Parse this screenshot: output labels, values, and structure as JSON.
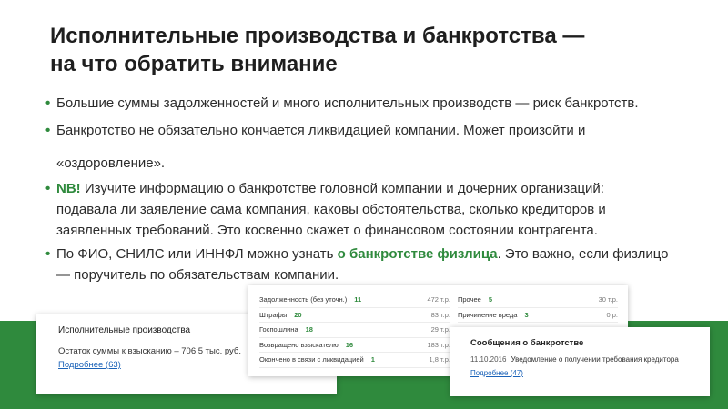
{
  "title_line1": "Исполнительные производства и банкротства —",
  "title_line2": "на что обратить внимание",
  "bullets": {
    "b1": "Большие суммы задолженностей и много исполнительных производств — риск банкротств.",
    "b2_line1": "Банкротство не обязательно кончается ликвидацией компании. Может произойти и",
    "b2_line2": "«оздоровление».",
    "b3_nb": "NB!",
    "b3_line1": " Изучите информацию о банкротстве головной компании и дочерних организаций:",
    "b3_line2": "подавала ли заявление сама компания, каковы обстоятельства, сколько кредиторов и",
    "b3_line3": "заявленных  требований. Это косвенно скажет о финансовом состоянии контрагента.",
    "b4_pre": "По ФИО, СНИЛС или ИННФЛ можно узнать ",
    "b4_hl": "о банкротстве физлица",
    "b4_post": ". Это важно, если физлицо",
    "b4_line2": "— поручитель по обязательствам компании."
  },
  "exec_card": {
    "heading": "Исполнительные производства",
    "balance": "Остаток суммы к взысканию – 706,5 тыс. руб.",
    "link": "Подробнее (63)"
  },
  "table_card": {
    "left": [
      {
        "label": "Задолженность (без уточн.)",
        "count": "11",
        "amount": "472 т.р."
      },
      {
        "label": "Штрафы",
        "count": "20",
        "amount": "83 т.р."
      },
      {
        "label": "Госпошлина",
        "count": "18",
        "amount": "29 т.р."
      },
      {
        "label": "Возвращено взыскателю",
        "count": "16",
        "amount": "183 т.р."
      },
      {
        "label": "Окончено в связи с ликвидацией",
        "count": "1",
        "amount": "1,8 т.р."
      }
    ],
    "right": [
      {
        "label": "Прочее",
        "count": "5",
        "amount": "30 т.р."
      },
      {
        "label": "Причинение вреда",
        "count": "3",
        "amount": "0 р."
      }
    ]
  },
  "bank_card": {
    "heading": "Сообщения о банкротстве",
    "date": "11.10.2016",
    "message": "Уведомление о получении требования кредитора",
    "link": "Подробнее (47)"
  },
  "colors": {
    "accent": "#2f8a3d",
    "link": "#1a62b8"
  }
}
